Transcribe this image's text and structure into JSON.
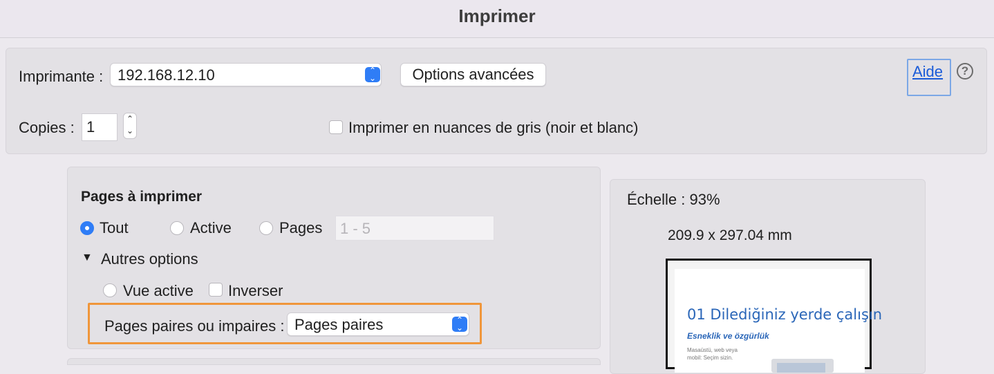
{
  "window": {
    "title": "Imprimer"
  },
  "printer": {
    "label": "Imprimante :",
    "value": "192.168.12.10"
  },
  "advanced_button": "Options avancées",
  "help": {
    "link": "Aide",
    "icon": "question-circle-icon",
    "icon_glyph": "?"
  },
  "copies": {
    "label": "Copies :",
    "value": "1"
  },
  "grayscale": {
    "label": "Imprimer en nuances de gris (noir et blanc)",
    "checked": false
  },
  "pages": {
    "heading": "Pages à imprimer",
    "options": [
      "Tout",
      "Active",
      "Pages"
    ],
    "selected": "Tout",
    "range_placeholder": "1 - 5",
    "more_options": "Autres options",
    "current_view": "Vue active",
    "reverse": "Inverser",
    "odd_even_label": "Pages paires ou impaires :",
    "odd_even_value": "Pages paires"
  },
  "preview": {
    "scale": "Échelle :  93%",
    "size": "209.9 x 297.04 mm",
    "doc_heading": "01 Dilediğiniz yerde çalışın",
    "doc_subheading": "Esneklik ve özgürlük",
    "doc_text": "Masaüstü, web veya mobil: Seçim sizin."
  },
  "colors": {
    "accent": "#2f7df6",
    "highlight": "#f0963a",
    "link": "#1a5bd8"
  }
}
